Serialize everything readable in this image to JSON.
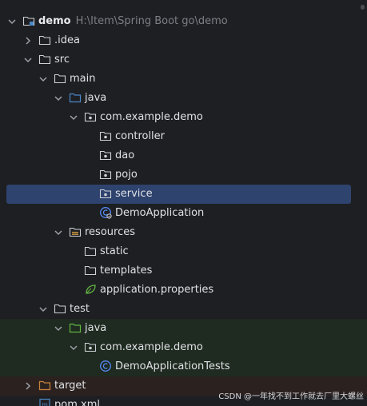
{
  "project_tree": {
    "root": {
      "label": "demo",
      "path": "H:\\Item\\Spring Boot go\\demo"
    },
    "idea": "idea",
    "src": "src",
    "main": "main",
    "main_java": "java",
    "package": "com.example.demo",
    "controller": "controller",
    "dao": "dao",
    "pojo": "pojo",
    "service": "service",
    "app_class": "DemoApplication",
    "resources": "resources",
    "static": "static",
    "templates": "templates",
    "app_props": "application.properties",
    "test": "test",
    "test_java": "java",
    "test_package": "com.example.demo",
    "test_class": "DemoApplicationTests",
    "target": "target",
    "pom": "pom.xml",
    "selected_item": "service"
  },
  "watermark": "CSDN @一年找不到工作就去厂里大螺丝",
  "colors": {
    "background": "#1e1f22",
    "selection": "#2e436e",
    "folder_source": "#4a88c7",
    "folder_test": "#62b543",
    "folder_target": "#c9823b",
    "class_icon": "#548af7"
  }
}
